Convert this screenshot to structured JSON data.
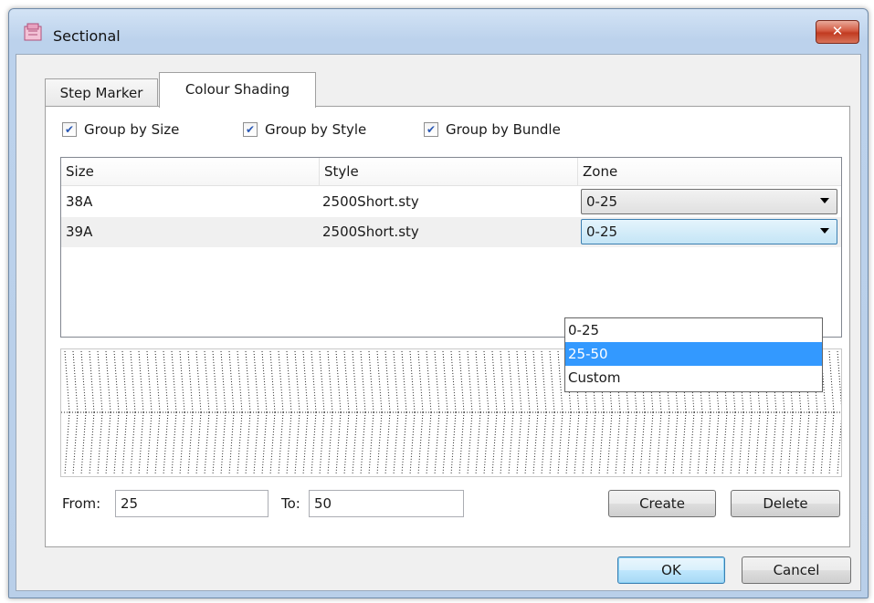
{
  "window": {
    "title": "Sectional",
    "close_symbol": "✕"
  },
  "tabs": [
    {
      "label": "Step Marker",
      "active": false
    },
    {
      "label": "Colour Shading",
      "active": true
    }
  ],
  "checkboxes": [
    {
      "label": "Group by Size",
      "checked": true
    },
    {
      "label": "Group by Style",
      "checked": true
    },
    {
      "label": "Group by Bundle",
      "checked": true
    }
  ],
  "table": {
    "columns": [
      "Size",
      "Style",
      "Zone"
    ],
    "rows": [
      {
        "size": "38A",
        "style": "2500Short.sty",
        "zone": "0-25"
      },
      {
        "size": "39A",
        "style": "2500Short.sty",
        "zone": "0-25"
      }
    ]
  },
  "dropdown": {
    "options": [
      "0-25",
      "25-50",
      "Custom"
    ],
    "highlighted": "25-50"
  },
  "range": {
    "from_label": "From:",
    "from_value": "25",
    "to_label": "To:",
    "to_value": "50"
  },
  "buttons": {
    "create": "Create",
    "delete": "Delete",
    "ok": "OK",
    "cancel": "Cancel"
  },
  "colors": {
    "highlight": "#3399ff",
    "title_bar": "#bcd2ec",
    "close_button": "#c13a20"
  }
}
